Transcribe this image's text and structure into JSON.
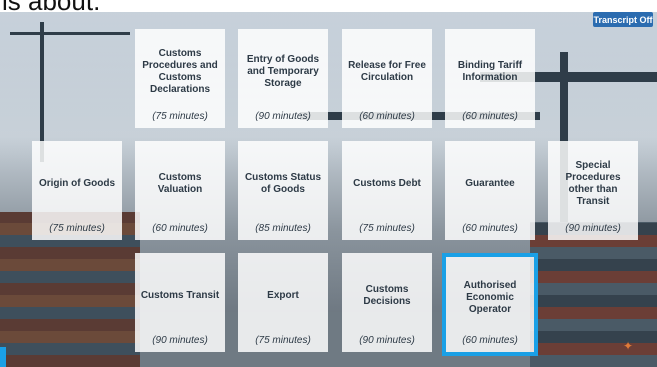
{
  "caption": "is about.",
  "transcript_button": "Transcript Off",
  "tiles": [
    {
      "title": "Customs Procedures and Customs Declarations",
      "duration": "(75 minutes)"
    },
    {
      "title": "Entry of Goods and Temporary Storage",
      "duration": "(90 minutes)"
    },
    {
      "title": "Release for Free Circulation",
      "duration": "(60 minutes)"
    },
    {
      "title": "Binding Tariff Information",
      "duration": "(60 minutes)"
    },
    {
      "title": "Origin of Goods",
      "duration": "(75 minutes)"
    },
    {
      "title": "Customs Valuation",
      "duration": "(60 minutes)"
    },
    {
      "title": "Customs Status of Goods",
      "duration": "(85 minutes)"
    },
    {
      "title": "Customs Debt",
      "duration": "(75 minutes)"
    },
    {
      "title": "Guarantee",
      "duration": "(60 minutes)"
    },
    {
      "title": "Special Procedures other than Transit",
      "duration": "(90 minutes)"
    },
    {
      "title": "Customs Transit",
      "duration": "(90 minutes)"
    },
    {
      "title": "Export",
      "duration": "(75 minutes)"
    },
    {
      "title": "Customs Decisions",
      "duration": "(90 minutes)"
    },
    {
      "title": "Authorised Economic Operator",
      "duration": "(60 minutes)"
    }
  ],
  "colors": {
    "selected_border": "#1aa0e6",
    "transcript_bg": "#2b6cb0"
  },
  "icons": {
    "nav": "compass-icon"
  }
}
